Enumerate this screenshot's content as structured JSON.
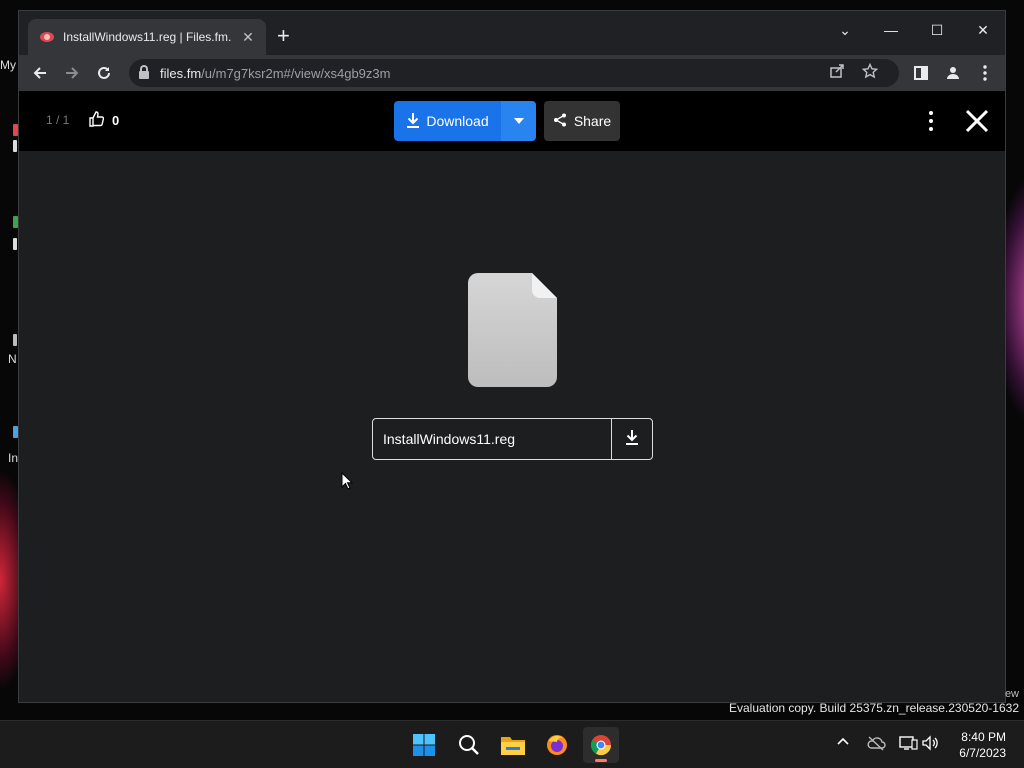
{
  "desktop": {
    "icons": [
      {
        "label": "My",
        "color": ""
      },
      {
        "label": "",
        "color": "#e0484f"
      },
      {
        "label": "",
        "color": "#3fa34d"
      },
      {
        "label": "N",
        "color": "#999999"
      },
      {
        "label": "In",
        "color": "#4aa3df"
      }
    ]
  },
  "browser": {
    "tab": {
      "title": "InstallWindows11.reg | Files.fm.",
      "close": "✕"
    },
    "new_tab": "+",
    "window_controls": {
      "tabsearch": "⌄",
      "minimize": "—",
      "maximize": "☐",
      "close": "✕"
    },
    "address": {
      "host": "files.fm",
      "path": "/u/m7g7ksr2m#/view/xs4gb9z3m"
    }
  },
  "viewer": {
    "counter": "1 / 1",
    "likes": "0",
    "download_label": "Download",
    "share_label": "Share",
    "file_name": "InstallWindows11.reg"
  },
  "watermark": {
    "edge": "ew",
    "text": "Evaluation copy. Build 25375.zn_release.230520-1632"
  },
  "taskbar": {
    "apps": [
      "start-icon",
      "search-icon",
      "file-explorer-icon",
      "firefox-icon",
      "chrome-icon"
    ],
    "time": "8:40 PM",
    "date": "6/7/2023"
  },
  "colors": {
    "accent": "#1a73e8",
    "viewer_bg": "#1d1e20",
    "chrome_tab": "#35363a"
  }
}
